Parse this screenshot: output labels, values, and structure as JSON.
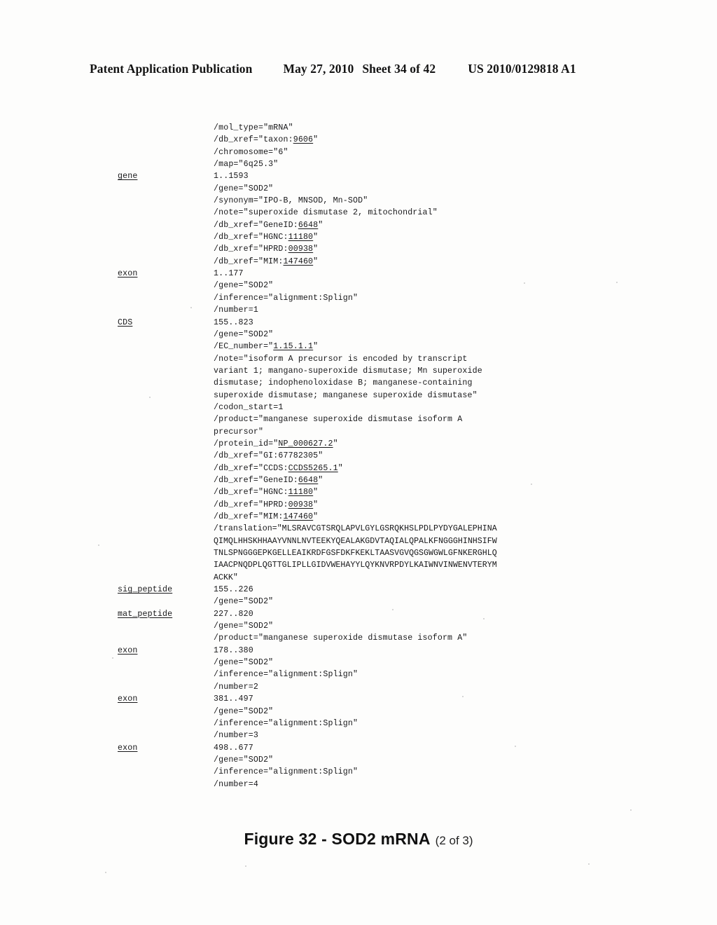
{
  "header": {
    "publication": "Patent Application Publication",
    "date": "May 27, 2010",
    "sheet": "Sheet 34 of 42",
    "patent_number": "US 2010/0129818 A1"
  },
  "caption": {
    "main": "Figure 32 - SOD2 mRNA",
    "sub": "(2 of 3)"
  },
  "features": [
    {
      "key": "",
      "lines": [
        "/mol_type=\"mRNA\""
      ]
    },
    {
      "key": "",
      "lines_rich": [
        {
          "pre": "/db_xref=\"taxon:",
          "link": "9606",
          "post": "\""
        }
      ]
    },
    {
      "key": "",
      "lines": [
        "/chromosome=\"6\"",
        "/map=\"6q25.3\""
      ]
    },
    {
      "key": "gene",
      "lines": [
        "1..1593",
        "/gene=\"SOD2\"",
        "/synonym=\"IPO-B, MNSOD, Mn-SOD\"",
        "/note=\"superoxide dismutase 2, mitochondrial\""
      ],
      "lines_rich": [
        {
          "pre": "/db_xref=\"GeneID:",
          "link": "6648",
          "post": "\""
        },
        {
          "pre": "/db_xref=\"HGNC:",
          "link": "11180",
          "post": "\""
        },
        {
          "pre": "/db_xref=\"HPRD:",
          "link": "00938",
          "post": "\""
        },
        {
          "pre": "/db_xref=\"MIM:",
          "link": "147460",
          "post": "\""
        }
      ]
    },
    {
      "key": "exon",
      "lines": [
        "1..177",
        "/gene=\"SOD2\"",
        "/inference=\"alignment:Splign\"",
        "/number=1"
      ]
    },
    {
      "key": "CDS",
      "lines": [
        "155..823",
        "/gene=\"SOD2\""
      ]
    },
    {
      "key": "sig_peptide",
      "lines": [
        "155..226",
        "/gene=\"SOD2\""
      ]
    },
    {
      "key": "mat_peptide",
      "lines": [
        "227..820",
        "/gene=\"SOD2\"",
        "/product=\"manganese superoxide dismutase isoform A\""
      ]
    },
    {
      "key": "exon",
      "lines": [
        "178..380",
        "/gene=\"SOD2\"",
        "/inference=\"alignment:Splign\"",
        "/number=2"
      ]
    },
    {
      "key": "exon",
      "lines": [
        "381..497",
        "/gene=\"SOD2\"",
        "/inference=\"alignment:Splign\"",
        "/number=3"
      ]
    },
    {
      "key": "exon",
      "lines": [
        "498..677",
        "/gene=\"SOD2\"",
        "/inference=\"alignment:Splign\"",
        "/number=4"
      ]
    }
  ],
  "qualifiers": {
    "mol_type": "/mol_type=\"mRNA\"",
    "db_xref_taxon_pre": "/db_xref=\"taxon:",
    "db_xref_taxon_link": "9606",
    "quote": "\"",
    "chromosome": "/chromosome=\"6\"",
    "map": "/map=\"6q25.3\"",
    "gene_range": "1..1593",
    "gene_name": "/gene=\"SOD2\"",
    "synonym": "/synonym=\"IPO-B, MNSOD, Mn-SOD\"",
    "gene_note": "/note=\"superoxide dismutase 2, mitochondrial\"",
    "geneid_pre": "/db_xref=\"GeneID:",
    "geneid_link": "6648",
    "hgnc_pre": "/db_xref=\"HGNC:",
    "hgnc_link": "11180",
    "hprd_pre": "/db_xref=\"HPRD:",
    "hprd_link": "00938",
    "mim_pre": "/db_xref=\"MIM:",
    "mim_link": "147460",
    "exon1_range": "1..177",
    "inference": "/inference=\"alignment:Splign\"",
    "number1": "/number=1",
    "cds_range": "155..823",
    "ec_pre": "/EC_number=\"",
    "ec_link": "1.15.1.1",
    "cds_note_l1": "/note=\"isoform A precursor is encoded by transcript",
    "cds_note_l2": "variant 1; mangano-superoxide dismutase; Mn superoxide",
    "cds_note_l3": "dismutase; indophenoloxidase B; manganese-containing",
    "cds_note_l4": "superoxide dismutase; manganese superoxide dismutase\"",
    "codon_start": "/codon_start=1",
    "product_l1": "/product=\"manganese superoxide dismutase isoform A",
    "product_l2": "precursor\"",
    "protein_id_pre": "/protein_id=\"",
    "protein_id_link": "NP_000627.2",
    "gi": "/db_xref=\"GI:67782305\"",
    "ccds_pre": "/db_xref=\"CCDS:",
    "ccds_link": "CCDS5265.1",
    "translation_l1": "/translation=\"MLSRAVCGTSRQLAPVLGYLGSRQKHSLPDLPYDYGALEPHINA",
    "translation_l2": "QIMQLHHSKHHAAYVNNLNVTEEKYQEALAKGDVTAQIALQPALKFNGGGHINHSIFW",
    "translation_l3": "TNLSPNGGGEPKGELLEAIKRDFGSFDKFKEKLTAASVGVQGSGWGWLGFNKERGHLQ",
    "translation_l4": "IAACPNQDPLQGTTGLIPLLGIDVWEHAYYLQYKNVRPDYLKAIWNVINWENVTERYM",
    "translation_l5": "ACKK\"",
    "sig_range": "155..226",
    "mat_range": "227..820",
    "mat_product": "/product=\"manganese superoxide dismutase isoform A\"",
    "exon2_range": "178..380",
    "number2": "/number=2",
    "exon3_range": "381..497",
    "number3": "/number=3",
    "exon4_range": "498..677",
    "number4": "/number=4"
  },
  "labels": {
    "gene": "gene",
    "exon": "exon",
    "cds": "CDS",
    "sig_peptide": "sig_peptide",
    "mat_peptide": "mat_peptide",
    "blank": ""
  }
}
